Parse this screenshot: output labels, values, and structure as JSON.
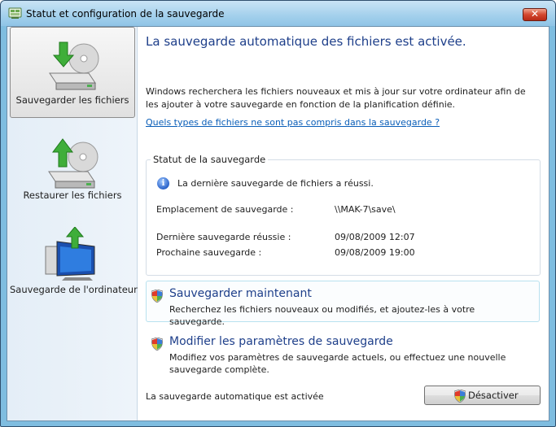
{
  "window": {
    "title": "Statut et configuration de la sauvegarde",
    "close_label": "✕"
  },
  "sidebar": {
    "items": [
      {
        "label": "Sauvegarder les fichiers",
        "icon": "backup-files-icon",
        "selected": true
      },
      {
        "label": "Restaurer les fichiers",
        "icon": "restore-files-icon",
        "selected": false
      },
      {
        "label": "Sauvegarde de l'ordinateur",
        "icon": "computer-backup-icon",
        "selected": false
      }
    ]
  },
  "main": {
    "heading": "La sauvegarde automatique des fichiers est activée.",
    "description": "Windows recherchera les fichiers nouveaux et mis à jour sur votre ordinateur afin de les ajouter à votre sauvegarde en fonction de la planification définie.",
    "link": "Quels types de fichiers ne sont pas compris dans la sauvegarde ?",
    "status_group": {
      "title": "Statut de la sauvegarde",
      "message": "La dernière sauvegarde de fichiers a réussi.",
      "location_label": "Emplacement de sauvegarde :",
      "location_value": "\\\\MAK-7\\save\\",
      "last_label": "Dernière sauvegarde réussie :",
      "last_value": "09/08/2009 12:07",
      "next_label": "Prochaine sauvegarde :",
      "next_value": "09/08/2009 19:00"
    },
    "actions": [
      {
        "title": "Sauvegarder maintenant",
        "description": "Recherchez les fichiers nouveaux ou modifiés, et ajoutez-les à votre sauvegarde."
      },
      {
        "title": "Modifier les paramètres de sauvegarde",
        "description": "Modifiez vos paramètres de sauvegarde actuels, ou effectuez une nouvelle sauvegarde complète."
      }
    ],
    "footer_status": "La sauvegarde automatique est activée",
    "disable_button": "Désactiver"
  },
  "colors": {
    "heading": "#1e3f8a",
    "link": "#0a5eb8",
    "frame": "#7fbde0"
  }
}
